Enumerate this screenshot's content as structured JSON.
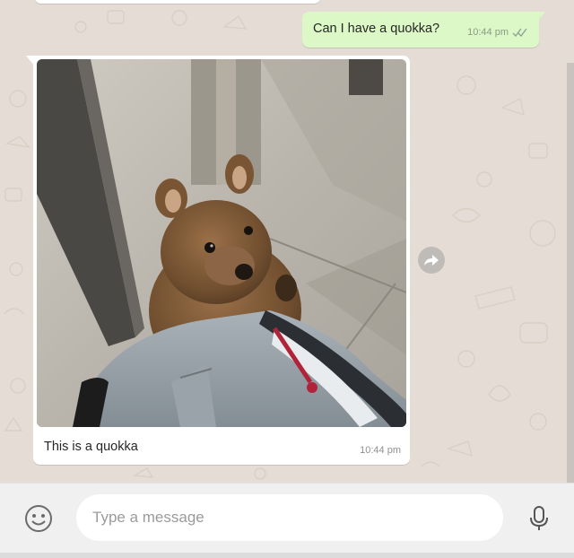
{
  "colors": {
    "wallpaper": "#e5ddd5",
    "outgoing_bubble": "#dcf8c6",
    "incoming_bubble": "#ffffff",
    "footer": "#f0f0f0"
  },
  "messages": [
    {
      "direction": "outgoing",
      "text": "Can I have a quokka?",
      "time": "10:44 pm",
      "status_icon": "double-check-icon"
    },
    {
      "direction": "incoming",
      "type": "image",
      "image_subject": "quokka",
      "caption": "This is a quokka",
      "time": "10:44 pm"
    }
  ],
  "actions": {
    "forward_icon": "forward-arrow-icon"
  },
  "composer": {
    "placeholder": "Type a message",
    "value": "",
    "emoji_icon": "smiley-icon",
    "mic_icon": "microphone-icon"
  }
}
